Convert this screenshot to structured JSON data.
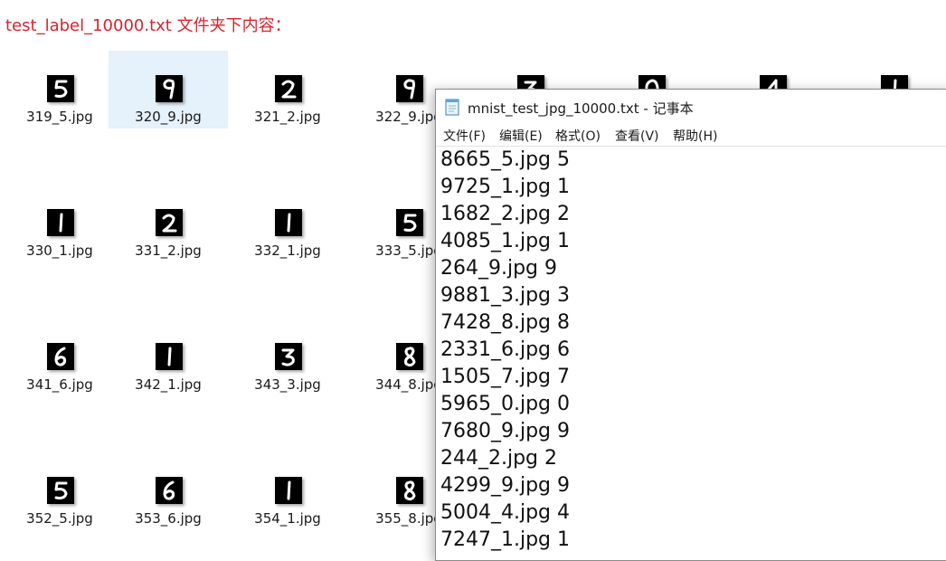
{
  "heading": "test_label_10000.txt 文件夹下内容：",
  "colors": {
    "heading": "#e0202a",
    "selection": "#e5f1fb",
    "digit_bg": "#000000",
    "digit_stroke": "#ffffff"
  },
  "thumbnails": [
    {
      "file": "319_5.jpg",
      "digit": "5"
    },
    {
      "file": "320_9.jpg",
      "digit": "9",
      "selected": true
    },
    {
      "file": "321_2.jpg",
      "digit": "2"
    },
    {
      "file": "322_9.jpg",
      "digit": "9"
    },
    {
      "file": "",
      "digit": "3"
    },
    {
      "file": "",
      "digit": "0"
    },
    {
      "file": "",
      "digit": "4"
    },
    {
      "file": "",
      "digit": "1"
    },
    {
      "file": "330_1.jpg",
      "digit": "1"
    },
    {
      "file": "331_2.jpg",
      "digit": "2"
    },
    {
      "file": "332_1.jpg",
      "digit": "1"
    },
    {
      "file": "333_5.jpg",
      "digit": "5"
    },
    {
      "file": "341_6.jpg",
      "digit": "6"
    },
    {
      "file": "342_1.jpg",
      "digit": "1"
    },
    {
      "file": "343_3.jpg",
      "digit": "3"
    },
    {
      "file": "344_8.jpg",
      "digit": "8"
    },
    {
      "file": "352_5.jpg",
      "digit": "5"
    },
    {
      "file": "353_6.jpg",
      "digit": "6"
    },
    {
      "file": "354_1.jpg",
      "digit": "1"
    },
    {
      "file": "355_8.jpg",
      "digit": "8"
    }
  ],
  "notepad": {
    "title": "mnist_test_jpg_10000.txt - 记事本",
    "icon": "notepad-icon",
    "menu": [
      "文件(F)",
      "编辑(E)",
      "格式(O)",
      "查看(V)",
      "帮助(H)"
    ],
    "lines": [
      "8665_5.jpg 5",
      "9725_1.jpg 1",
      "1682_2.jpg 2",
      "4085_1.jpg 1",
      "264_9.jpg 9",
      "9881_3.jpg 3",
      "7428_8.jpg 8",
      "2331_6.jpg 6",
      "1505_7.jpg 7",
      "5965_0.jpg 0",
      "7680_9.jpg 9",
      "244_2.jpg 2",
      "4299_9.jpg 9",
      "5004_4.jpg 4",
      "7247_1.jpg 1"
    ]
  }
}
